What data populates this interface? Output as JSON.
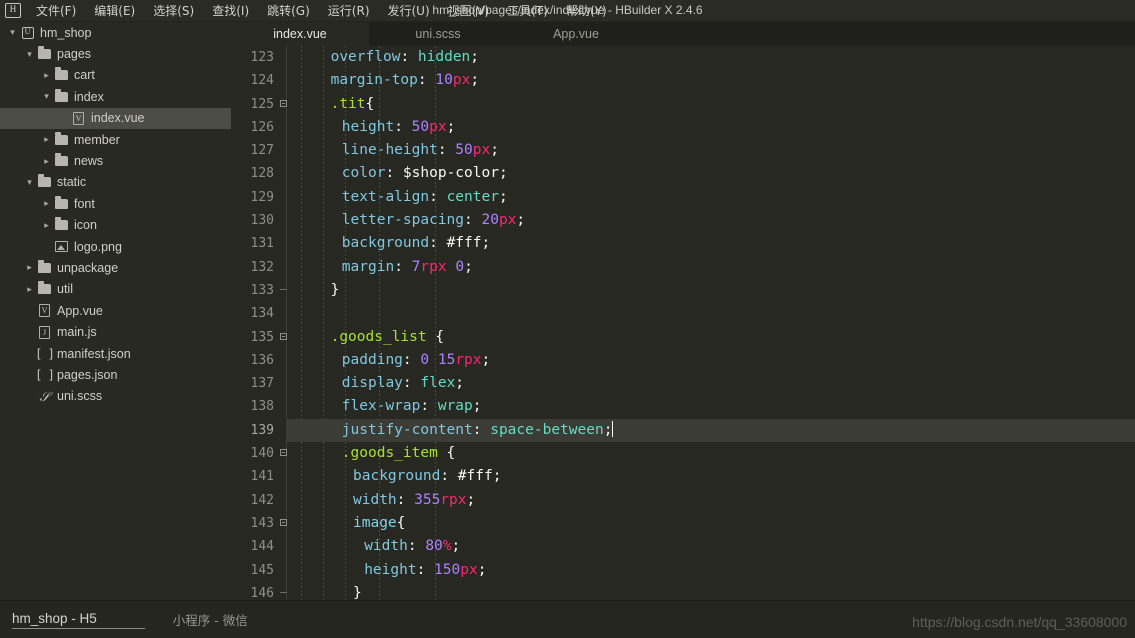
{
  "window": {
    "title": "hm_shop/pages/index/index.vue - HBuilder X 2.4.6",
    "logo_icon": "hbuilder-logo-icon"
  },
  "menubar": {
    "items": [
      {
        "label": "文件(F)"
      },
      {
        "label": "编辑(E)"
      },
      {
        "label": "选择(S)"
      },
      {
        "label": "查找(I)"
      },
      {
        "label": "跳转(G)"
      },
      {
        "label": "运行(R)"
      },
      {
        "label": "发行(U)"
      },
      {
        "label": "视图(V)"
      },
      {
        "label": "工具(T)"
      },
      {
        "label": "帮助(Y)"
      }
    ]
  },
  "sidebar": {
    "items": [
      {
        "label": "hm_shop",
        "depth": 0,
        "twisty": "open",
        "icon": "project-root-icon",
        "selected": false
      },
      {
        "label": "pages",
        "depth": 1,
        "twisty": "open",
        "icon": "folder-icon",
        "selected": false
      },
      {
        "label": "cart",
        "depth": 2,
        "twisty": "closed",
        "icon": "folder-icon",
        "selected": false
      },
      {
        "label": "index",
        "depth": 2,
        "twisty": "open",
        "icon": "folder-icon",
        "selected": false
      },
      {
        "label": "index.vue",
        "depth": 3,
        "twisty": "none",
        "icon": "vue-file-icon",
        "selected": true
      },
      {
        "label": "member",
        "depth": 2,
        "twisty": "closed",
        "icon": "folder-icon",
        "selected": false
      },
      {
        "label": "news",
        "depth": 2,
        "twisty": "closed",
        "icon": "folder-icon",
        "selected": false
      },
      {
        "label": "static",
        "depth": 1,
        "twisty": "open",
        "icon": "folder-icon",
        "selected": false
      },
      {
        "label": "font",
        "depth": 2,
        "twisty": "closed",
        "icon": "folder-icon",
        "selected": false
      },
      {
        "label": "icon",
        "depth": 2,
        "twisty": "closed",
        "icon": "folder-icon",
        "selected": false
      },
      {
        "label": "logo.png",
        "depth": 2,
        "twisty": "none",
        "icon": "image-file-icon",
        "selected": false
      },
      {
        "label": "unpackage",
        "depth": 1,
        "twisty": "closed",
        "icon": "folder-icon",
        "selected": false
      },
      {
        "label": "util",
        "depth": 1,
        "twisty": "closed",
        "icon": "folder-icon",
        "selected": false
      },
      {
        "label": "App.vue",
        "depth": 1,
        "twisty": "none",
        "icon": "vue-file-icon",
        "selected": false
      },
      {
        "label": "main.js",
        "depth": 1,
        "twisty": "none",
        "icon": "js-file-icon",
        "selected": false
      },
      {
        "label": "manifest.json",
        "depth": 1,
        "twisty": "none",
        "icon": "json-file-icon",
        "selected": false
      },
      {
        "label": "pages.json",
        "depth": 1,
        "twisty": "none",
        "icon": "json-file-icon",
        "selected": false
      },
      {
        "label": "uni.scss",
        "depth": 1,
        "twisty": "none",
        "icon": "scss-file-icon",
        "selected": false
      }
    ]
  },
  "tabs": [
    {
      "label": "index.vue",
      "active": true
    },
    {
      "label": "uni.scss",
      "active": false
    },
    {
      "label": "App.vue",
      "active": false
    }
  ],
  "editor": {
    "first_line": 123,
    "active_line": 139,
    "lines": [
      {
        "n": 123,
        "fold": "bar",
        "indent": 3,
        "tokens": [
          {
            "t": "overflow",
            "c": "prop"
          },
          {
            "t": ": ",
            "c": "punct"
          },
          {
            "t": "hidden",
            "c": "val"
          },
          {
            "t": ";",
            "c": "punct"
          }
        ]
      },
      {
        "n": 124,
        "fold": "bar",
        "indent": 3,
        "tokens": [
          {
            "t": "margin-top",
            "c": "prop"
          },
          {
            "t": ": ",
            "c": "punct"
          },
          {
            "t": "10",
            "c": "num"
          },
          {
            "t": "px",
            "c": "unit"
          },
          {
            "t": ";",
            "c": "punct"
          }
        ]
      },
      {
        "n": 125,
        "fold": "box",
        "indent": 3,
        "tokens": [
          {
            "t": ".tit",
            "c": "sel"
          },
          {
            "t": "{",
            "c": "punct"
          }
        ]
      },
      {
        "n": 126,
        "fold": "bar",
        "indent": 4,
        "tokens": [
          {
            "t": "height",
            "c": "prop"
          },
          {
            "t": ": ",
            "c": "punct"
          },
          {
            "t": "50",
            "c": "num"
          },
          {
            "t": "px",
            "c": "unit"
          },
          {
            "t": ";",
            "c": "punct"
          }
        ]
      },
      {
        "n": 127,
        "fold": "bar",
        "indent": 4,
        "tokens": [
          {
            "t": "line-height",
            "c": "prop"
          },
          {
            "t": ": ",
            "c": "punct"
          },
          {
            "t": "50",
            "c": "num"
          },
          {
            "t": "px",
            "c": "unit"
          },
          {
            "t": ";",
            "c": "punct"
          }
        ]
      },
      {
        "n": 128,
        "fold": "bar",
        "indent": 4,
        "tokens": [
          {
            "t": "color",
            "c": "prop"
          },
          {
            "t": ": ",
            "c": "punct"
          },
          {
            "t": "$shop-color",
            "c": "var"
          },
          {
            "t": ";",
            "c": "punct"
          }
        ]
      },
      {
        "n": 129,
        "fold": "bar",
        "indent": 4,
        "tokens": [
          {
            "t": "text-align",
            "c": "prop"
          },
          {
            "t": ": ",
            "c": "punct"
          },
          {
            "t": "center",
            "c": "val"
          },
          {
            "t": ";",
            "c": "punct"
          }
        ]
      },
      {
        "n": 130,
        "fold": "bar",
        "indent": 4,
        "tokens": [
          {
            "t": "letter-spacing",
            "c": "prop"
          },
          {
            "t": ": ",
            "c": "punct"
          },
          {
            "t": "20",
            "c": "num"
          },
          {
            "t": "px",
            "c": "unit"
          },
          {
            "t": ";",
            "c": "punct"
          }
        ]
      },
      {
        "n": 131,
        "fold": "bar",
        "indent": 4,
        "tokens": [
          {
            "t": "background",
            "c": "prop"
          },
          {
            "t": ": ",
            "c": "punct"
          },
          {
            "t": "#fff",
            "c": "hex"
          },
          {
            "t": ";",
            "c": "punct"
          }
        ]
      },
      {
        "n": 132,
        "fold": "bar",
        "indent": 4,
        "tokens": [
          {
            "t": "margin",
            "c": "prop"
          },
          {
            "t": ": ",
            "c": "punct"
          },
          {
            "t": "7",
            "c": "num"
          },
          {
            "t": "rpx",
            "c": "unit"
          },
          {
            "t": " ",
            "c": "punct"
          },
          {
            "t": "0",
            "c": "num"
          },
          {
            "t": ";",
            "c": "punct"
          }
        ]
      },
      {
        "n": 133,
        "fold": "dash",
        "indent": 3,
        "tokens": [
          {
            "t": "}",
            "c": "punct"
          }
        ]
      },
      {
        "n": 134,
        "fold": "none",
        "indent": 0,
        "tokens": []
      },
      {
        "n": 135,
        "fold": "box",
        "indent": 3,
        "tokens": [
          {
            "t": ".goods_list",
            "c": "sel"
          },
          {
            "t": " {",
            "c": "punct"
          }
        ]
      },
      {
        "n": 136,
        "fold": "bar",
        "indent": 4,
        "tokens": [
          {
            "t": "padding",
            "c": "prop"
          },
          {
            "t": ": ",
            "c": "punct"
          },
          {
            "t": "0",
            "c": "num"
          },
          {
            "t": " ",
            "c": "punct"
          },
          {
            "t": "15",
            "c": "num"
          },
          {
            "t": "rpx",
            "c": "unit"
          },
          {
            "t": ";",
            "c": "punct"
          }
        ]
      },
      {
        "n": 137,
        "fold": "bar",
        "indent": 4,
        "tokens": [
          {
            "t": "display",
            "c": "prop"
          },
          {
            "t": ": ",
            "c": "punct"
          },
          {
            "t": "flex",
            "c": "val"
          },
          {
            "t": ";",
            "c": "punct"
          }
        ]
      },
      {
        "n": 138,
        "fold": "bar",
        "indent": 4,
        "tokens": [
          {
            "t": "flex-wrap",
            "c": "prop"
          },
          {
            "t": ": ",
            "c": "punct"
          },
          {
            "t": "wrap",
            "c": "val"
          },
          {
            "t": ";",
            "c": "punct"
          }
        ]
      },
      {
        "n": 139,
        "fold": "bar",
        "indent": 4,
        "cursor": true,
        "tokens": [
          {
            "t": "justify-content",
            "c": "prop"
          },
          {
            "t": ": ",
            "c": "punct"
          },
          {
            "t": "space-between",
            "c": "val"
          },
          {
            "t": ";",
            "c": "punct"
          }
        ]
      },
      {
        "n": 140,
        "fold": "box",
        "indent": 4,
        "tokens": [
          {
            "t": ".goods_item",
            "c": "sel"
          },
          {
            "t": " {",
            "c": "punct"
          }
        ]
      },
      {
        "n": 141,
        "fold": "bar",
        "indent": 5,
        "tokens": [
          {
            "t": "background",
            "c": "prop"
          },
          {
            "t": ": ",
            "c": "punct"
          },
          {
            "t": "#fff",
            "c": "hex"
          },
          {
            "t": ";",
            "c": "punct"
          }
        ]
      },
      {
        "n": 142,
        "fold": "bar",
        "indent": 5,
        "tokens": [
          {
            "t": "width",
            "c": "prop"
          },
          {
            "t": ": ",
            "c": "punct"
          },
          {
            "t": "355",
            "c": "num"
          },
          {
            "t": "rpx",
            "c": "unit"
          },
          {
            "t": ";",
            "c": "punct"
          }
        ]
      },
      {
        "n": 143,
        "fold": "box",
        "indent": 5,
        "tokens": [
          {
            "t": "image",
            "c": "tag"
          },
          {
            "t": "{",
            "c": "punct"
          }
        ]
      },
      {
        "n": 144,
        "fold": "bar",
        "indent": 6,
        "tokens": [
          {
            "t": "width",
            "c": "prop"
          },
          {
            "t": ": ",
            "c": "punct"
          },
          {
            "t": "80",
            "c": "num"
          },
          {
            "t": "%",
            "c": "unit"
          },
          {
            "t": ";",
            "c": "punct"
          }
        ]
      },
      {
        "n": 145,
        "fold": "bar",
        "indent": 6,
        "tokens": [
          {
            "t": "height",
            "c": "prop"
          },
          {
            "t": ": ",
            "c": "punct"
          },
          {
            "t": "150",
            "c": "num"
          },
          {
            "t": "px",
            "c": "unit"
          },
          {
            "t": ";",
            "c": "punct"
          }
        ]
      },
      {
        "n": 146,
        "fold": "dash",
        "indent": 5,
        "tokens": [
          {
            "t": "}",
            "c": "punct"
          }
        ]
      }
    ]
  },
  "statusbar": {
    "project": "hm_shop - H5",
    "alt_target": "小程序 - 微信"
  },
  "watermark": {
    "text": "https://blog.csdn.net/qq_33608000",
    "overlay": "qq_33608000"
  },
  "theme": {
    "editor_bg": "#272822",
    "sidebar_bg": "#282923",
    "menubar_bg": "#2b2b26",
    "active_line_bg": "#3b3c35",
    "selection_bg": "#4c4c46",
    "property": "#80c7e0",
    "value_keyword": "#66d9c4",
    "number": "#ae81ff",
    "unit": "#f92672",
    "selector": "#a6e22e",
    "tag": "#7fd3e8",
    "foreground": "#f8f8f2"
  }
}
